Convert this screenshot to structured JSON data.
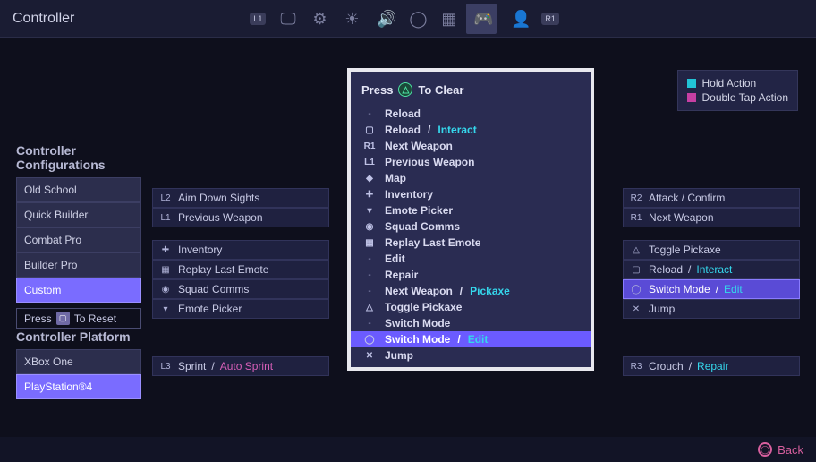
{
  "header": {
    "title": "Controller",
    "bumper_left": "L1",
    "bumper_right": "R1"
  },
  "legend": {
    "hold": "Hold Action",
    "double": "Double Tap Action"
  },
  "sections": {
    "configs": "Controller Configurations",
    "platform": "Controller Platform"
  },
  "configs": {
    "items": [
      "Old School",
      "Quick Builder",
      "Combat Pro",
      "Builder Pro",
      "Custom"
    ],
    "selected": 4,
    "reset_pre": "Press",
    "reset_btn": "▢",
    "reset_post": "To Reset"
  },
  "platform": {
    "items": [
      "XBox One",
      "PlayStation®4"
    ],
    "selected": 1
  },
  "leftcol": {
    "a": [
      {
        "icon": "L2",
        "label": "Aim Down Sights"
      },
      {
        "icon": "L1",
        "label": "Previous Weapon"
      }
    ],
    "b": [
      {
        "icon": "✚",
        "label": "Inventory"
      },
      {
        "icon": "▦",
        "label": "Replay Last Emote"
      },
      {
        "icon": "◉",
        "label": "Squad Comms"
      },
      {
        "icon": "▾",
        "label": "Emote Picker"
      }
    ],
    "sprint": {
      "icon": "L3",
      "label": "Sprint",
      "alt": "Auto Sprint"
    }
  },
  "rightcol": {
    "a": [
      {
        "icon": "R2",
        "label": "Attack / Confirm"
      },
      {
        "icon": "R1",
        "label": "Next Weapon"
      }
    ],
    "b": [
      {
        "icon": "△",
        "label": "Toggle Pickaxe"
      },
      {
        "icon": "▢",
        "label": "Reload",
        "alt": "Interact"
      },
      {
        "icon": "◯",
        "label": "Switch Mode",
        "alt": "Edit",
        "hl": true
      },
      {
        "icon": "✕",
        "label": "Jump"
      }
    ],
    "crouch": {
      "icon": "R3",
      "label": "Crouch",
      "alt": "Repair"
    }
  },
  "popup": {
    "hint_pre": "Press",
    "hint_post": "To Clear",
    "items": [
      {
        "icon": "-",
        "label": "Reload"
      },
      {
        "icon": "▢",
        "label": "Reload",
        "alt": "Interact"
      },
      {
        "icon": "R1",
        "label": "Next Weapon"
      },
      {
        "icon": "L1",
        "label": "Previous Weapon"
      },
      {
        "icon": "◆",
        "label": "Map"
      },
      {
        "icon": "✚",
        "label": "Inventory"
      },
      {
        "icon": "▾",
        "label": "Emote Picker"
      },
      {
        "icon": "◉",
        "label": "Squad Comms"
      },
      {
        "icon": "▦",
        "label": "Replay Last Emote"
      },
      {
        "icon": "-",
        "label": "Edit"
      },
      {
        "icon": "-",
        "label": "Repair"
      },
      {
        "icon": "-",
        "label": "Next Weapon",
        "alt": "Pickaxe"
      },
      {
        "icon": "△",
        "label": "Toggle Pickaxe"
      },
      {
        "icon": "-",
        "label": "Switch Mode"
      },
      {
        "icon": "◯",
        "label": "Switch Mode",
        "alt": "Edit",
        "sel": true
      },
      {
        "icon": "✕",
        "label": "Jump"
      }
    ]
  },
  "footer": {
    "back": "Back"
  }
}
